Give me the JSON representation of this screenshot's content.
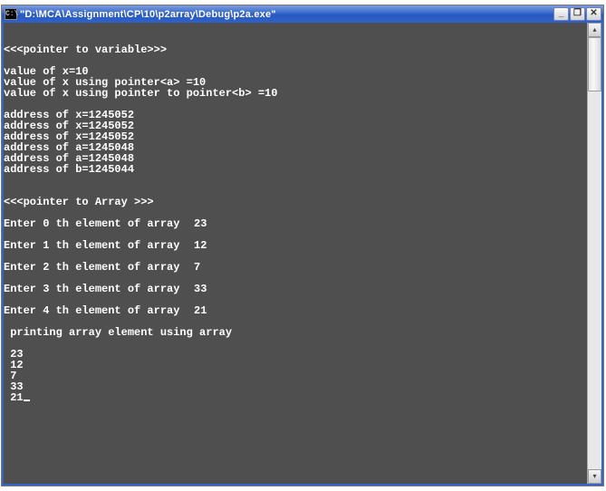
{
  "titlebar": {
    "icon_text": "C:\\",
    "title": "\"D:\\MCA\\Assignment\\CP\\10\\p2array\\Debug\\p2a.exe\"",
    "minimize": "_",
    "maximize": "❐",
    "close": "✕"
  },
  "scrollbar": {
    "up": "▴",
    "down": "▾"
  },
  "console": {
    "blank": "",
    "section1_header": "<<<pointer to variable>>>",
    "val_x": "value of x=10",
    "val_x_ptr": "value of x using pointer<a> =10",
    "val_x_pptr": "value of x using pointer to pointer<b> =10",
    "addr_x1": "address of x=1245052",
    "addr_x2": "address of x=1245052",
    "addr_x3": "address of x=1245052",
    "addr_a1": "address of a=1245048",
    "addr_a2": "address of a=1245048",
    "addr_b1": "address of b=1245044",
    "section2_header": "<<<pointer to Array >>>",
    "prompts": [
      {
        "label": "Enter 0 th element of array",
        "input": "23"
      },
      {
        "label": "Enter 1 th element of array",
        "input": "12"
      },
      {
        "label": "Enter 2 th element of array",
        "input": "7"
      },
      {
        "label": "Enter 3 th element of array",
        "input": "33"
      },
      {
        "label": "Enter 4 th element of array",
        "input": "21"
      }
    ],
    "print_header": " printing array element using array",
    "outputs": [
      " 23",
      " 12",
      " 7",
      " 33",
      " 21"
    ]
  }
}
